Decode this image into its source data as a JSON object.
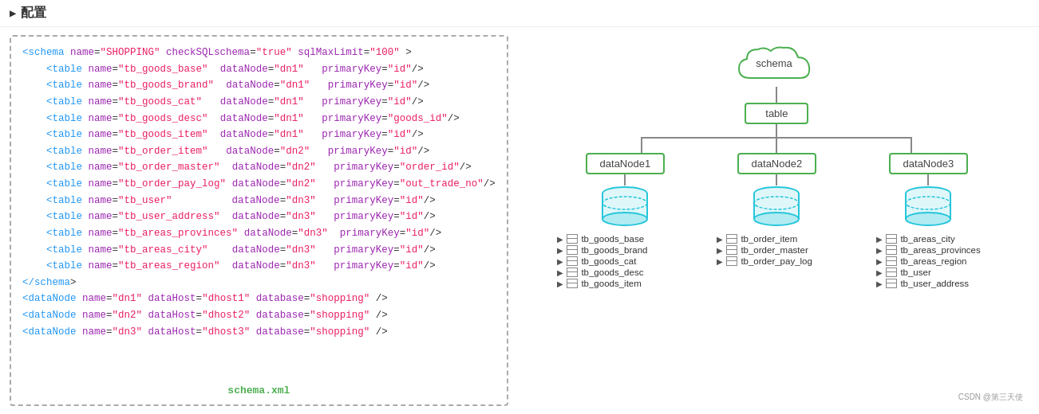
{
  "header": {
    "arrow": "▶",
    "title": "配置"
  },
  "left": {
    "code_lines": [
      {
        "text": "<schema name=\"SHOPPING\" checkSQLschema=\"true\" sqlMaxLimit=\"100\" >"
      },
      {
        "text": "    <table name=\"tb_goods_base\"  dataNode=\"dn1\"   primaryKey=\"id\"/>"
      },
      {
        "text": "    <table name=\"tb_goods_brand\"  dataNode=\"dn1\"   primaryKey=\"id\"/>"
      },
      {
        "text": "    <table name=\"tb_goods_cat\"   dataNode=\"dn1\"   primaryKey=\"id\"/>"
      },
      {
        "text": "    <table name=\"tb_goods_desc\"  dataNode=\"dn1\"   primaryKey=\"goods_id\"/>"
      },
      {
        "text": "    <table name=\"tb_goods_item\"  dataNode=\"dn1\"   primaryKey=\"id\"/>"
      },
      {
        "text": ""
      },
      {
        "text": "    <table name=\"tb_order_item\"   dataNode=\"dn2\"   primaryKey=\"id\"/>"
      },
      {
        "text": "    <table name=\"tb_order_master\"  dataNode=\"dn2\"   primaryKey=\"order_id\"/>"
      },
      {
        "text": "    <table name=\"tb_order_pay_log\" dataNode=\"dn2\"   primaryKey=\"out_trade_no\"/>"
      },
      {
        "text": ""
      },
      {
        "text": "    <table name=\"tb_user\"          dataNode=\"dn3\"   primaryKey=\"id\"/>"
      },
      {
        "text": "    <table name=\"tb_user_address\"  dataNode=\"dn3\"   primaryKey=\"id\"/>"
      },
      {
        "text": "    <table name=\"tb_areas_provinces\" dataNode=\"dn3\"  primaryKey=\"id\"/>"
      },
      {
        "text": "    <table name=\"tb_areas_city\"    dataNode=\"dn3\"   primaryKey=\"id\"/>"
      },
      {
        "text": "    <table name=\"tb_areas_region\"  dataNode=\"dn3\"   primaryKey=\"id\"/>"
      },
      {
        "text": "</schema>"
      },
      {
        "text": ""
      },
      {
        "text": "<dataNode name=\"dn1\" dataHost=\"dhost1\" database=\"shopping\" />"
      },
      {
        "text": "<dataNode name=\"dn2\" dataHost=\"dhost2\" database=\"shopping\" />"
      },
      {
        "text": "<dataNode name=\"dn3\" dataHost=\"dhost3\" database=\"shopping\" />"
      }
    ],
    "footer_label": "schema.xml"
  },
  "right": {
    "schema_label": "schema",
    "table_label": "table",
    "nodes": [
      {
        "label": "dataNode1"
      },
      {
        "label": "dataNode2"
      },
      {
        "label": "dataNode3"
      }
    ],
    "columns": [
      {
        "tables": [
          "tb_goods_base",
          "tb_goods_brand",
          "tb_goods_cat",
          "tb_goods_desc",
          "tb_goods_item"
        ]
      },
      {
        "tables": [
          "tb_order_item",
          "tb_order_master",
          "tb_order_pay_log"
        ]
      },
      {
        "tables": [
          "tb_areas_city",
          "tb_areas_provinces",
          "tb_areas_region",
          "tb_user",
          "tb_user_address"
        ]
      }
    ]
  },
  "watermark": "CSDN @第三天使"
}
